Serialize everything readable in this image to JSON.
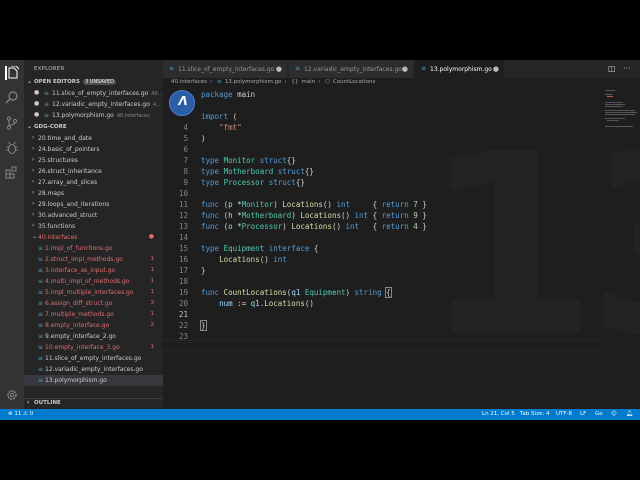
{
  "sidebar": {
    "title": "EXPLORER",
    "open_editors": {
      "title": "OPEN EDITORS",
      "badge": "3 UNSAVED",
      "items": [
        {
          "label": "11.slice_of_empty_interfaces.go",
          "sub": "40..."
        },
        {
          "label": "12.variadic_empty_interfaces.go",
          "sub": "4..."
        },
        {
          "label": "13.polymorphism.go",
          "sub": "40.interfaces"
        }
      ]
    },
    "workspace": {
      "title": "GDG-CORE",
      "folders": [
        "20.time_and_date",
        "24.basic_of_pointers",
        "25.structures",
        "26.struct_inheritance",
        "27.array_and_slices",
        "28.maps",
        "29.loops_and_iterations",
        "30.advanced_struct",
        "35.functions"
      ],
      "open_folder": {
        "label": "40.interfaces"
      },
      "files": [
        {
          "label": "1.impl_of_functions.go",
          "count": "",
          "color": "#dd6f6f"
        },
        {
          "label": "2.struct_impl_methods.go",
          "count": "1",
          "color": "#dd6f6f"
        },
        {
          "label": "3.interface_as_input.go",
          "count": "1",
          "color": "#dd6f6f"
        },
        {
          "label": "4.multi_impl_of_methods.go",
          "count": "1",
          "color": "#dd6f6f"
        },
        {
          "label": "5.impl_multiple_interfaces.go",
          "count": "1",
          "color": "#dd6f6f"
        },
        {
          "label": "6.assign_diff_struct.go",
          "count": "3",
          "color": "#dd6f6f"
        },
        {
          "label": "7.multiple_methods.go",
          "count": "1",
          "color": "#dd6f6f"
        },
        {
          "label": "8.empty_interface.go",
          "count": "2",
          "color": "#dd6f6f"
        },
        {
          "label": "9.empty_interface_2.go",
          "count": "",
          "color": "#cccccc"
        },
        {
          "label": "10.empty_interface_3.go",
          "count": "1",
          "color": "#dd6f6f"
        },
        {
          "label": "11.slice_of_empty_interfaces.go",
          "count": "",
          "color": "#cccccc"
        },
        {
          "label": "12.variadic_empty_interfaces.go",
          "count": "",
          "color": "#cccccc"
        },
        {
          "label": "13.polymorphism.go",
          "count": "",
          "color": "#cccccc"
        }
      ]
    },
    "outline": {
      "title": "OUTLINE"
    }
  },
  "tabs": [
    {
      "label": "11.slice_of_empty_interfaces.go"
    },
    {
      "label": "12.variadic_empty_interfaces.go"
    },
    {
      "label": "13.polymorphism.go"
    }
  ],
  "breadcrumb": {
    "folder": "40.interfaces",
    "file": "13.polymorphism.go",
    "symbol1": "main",
    "symbol2": "CountLocations"
  },
  "editor": {
    "line_numbers": [
      "",
      "",
      "",
      "4",
      "5",
      "6",
      "7",
      "8",
      "9",
      "10",
      "11",
      "12",
      "13",
      "14",
      "15",
      "16",
      "17",
      "18",
      "19",
      "20",
      "21",
      "22",
      "23"
    ],
    "lines": [
      "package main",
      "",
      "import (",
      "    \"fmt\"",
      ")",
      "",
      "type Monitor struct{}",
      "type Motherboard struct{}",
      "type Processor struct{}",
      "",
      "func (p *Monitor) Locations() int     { return 7 }",
      "func (h *Motherboard) Locations() int { return 9 }",
      "func (o *Processor) Locations() int   { return 4 }",
      "",
      "type Equipment interface {",
      "    Locations() int",
      "}",
      "",
      "func CountLocations(q1 Equipment) string {",
      "    num := q1.Locations()",
      "",
      "}",
      ""
    ],
    "watermark": "13"
  },
  "status": {
    "errors": "11",
    "warnings": "0",
    "position": "Ln 21, Col 5",
    "tab_size": "Tab Size: 4",
    "encoding": "UTF-8",
    "eol": "LF",
    "language": "Go"
  },
  "colors": {
    "accent": "#007acc",
    "error": "#dd6f6f"
  }
}
